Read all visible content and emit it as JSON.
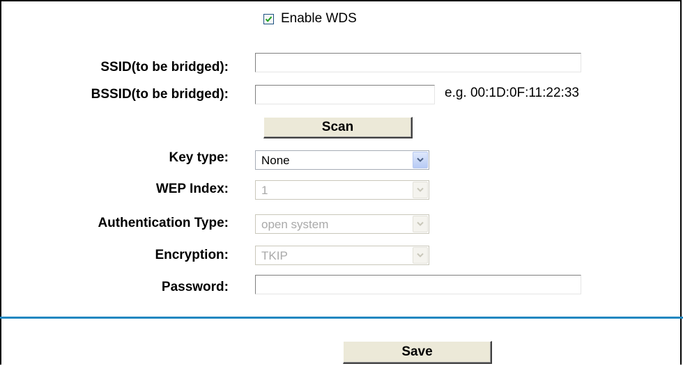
{
  "wds": {
    "enable_label": "Enable WDS",
    "enabled": true
  },
  "form": {
    "ssid": {
      "label": "SSID(to be bridged):",
      "value": ""
    },
    "bssid": {
      "label": "BSSID(to be bridged):",
      "value": "",
      "example": "e.g. 00:1D:0F:11:22:33"
    },
    "scan_button": "Scan",
    "key_type": {
      "label": "Key type:",
      "value": "None",
      "enabled": true
    },
    "wep_index": {
      "label": "WEP Index:",
      "value": "1",
      "enabled": false
    },
    "auth_type": {
      "label": "Authentication Type:",
      "value": "open system",
      "enabled": false
    },
    "encryption": {
      "label": "Encryption:",
      "value": "TKIP",
      "enabled": false
    },
    "password": {
      "label": "Password:",
      "value": ""
    }
  },
  "footer": {
    "save_button": "Save"
  },
  "colors": {
    "divider": "#1c87c0",
    "button_face": "#ece9d8",
    "checkbox_tick": "#21a121",
    "disabled_text": "#a9a9a9"
  },
  "icons": {
    "checkbox": "check-icon",
    "dropdown": "chevron-down-icon"
  }
}
